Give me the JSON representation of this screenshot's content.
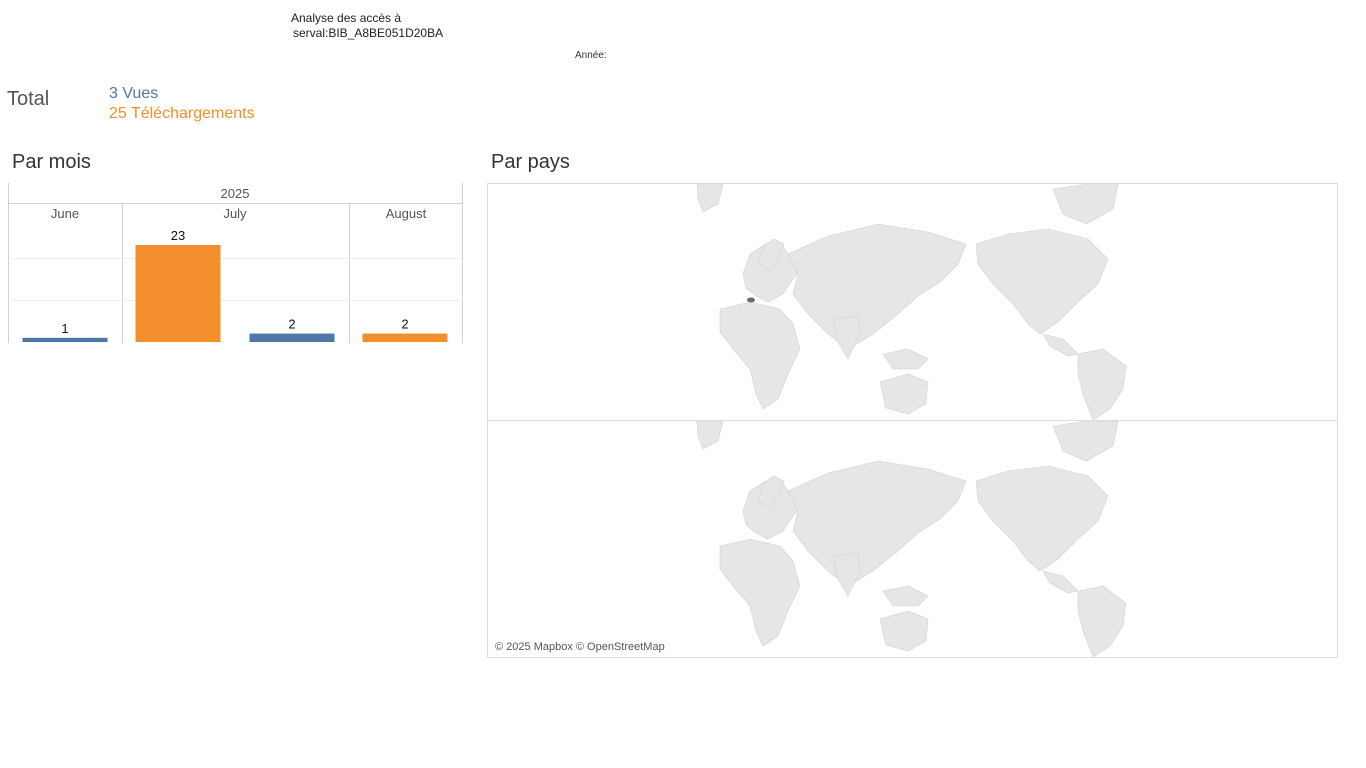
{
  "header": {
    "title_line1": "Analyse des accès à",
    "title_line2": "serval:BIB_A8BE051D20BA",
    "year_filter_label": "Année:"
  },
  "totals": {
    "label": "Total",
    "views": "3 Vues",
    "downloads": "25 Téléchargements"
  },
  "sections": {
    "by_month": "Par mois",
    "by_country": "Par pays"
  },
  "colors": {
    "views": "#4e79a7",
    "downloads": "#f28e2b",
    "map_land": "#e6e6e6",
    "map_highlight": "#6b6b6b",
    "grid": "#eeeeee"
  },
  "chart_data": {
    "type": "bar",
    "year_header": "2025",
    "categories": [
      "June",
      "July",
      "August"
    ],
    "series": [
      {
        "key": "views",
        "values": [
          1,
          2,
          null
        ]
      },
      {
        "key": "downloads",
        "values": [
          null,
          23,
          2
        ]
      }
    ],
    "bars": [
      {
        "month": "June",
        "series": "views",
        "value": 1,
        "label": "1"
      },
      {
        "month": "July",
        "series": "downloads",
        "value": 23,
        "label": "23"
      },
      {
        "month": "July",
        "series": "views",
        "value": 2,
        "label": "2"
      },
      {
        "month": "August",
        "series": "downloads",
        "value": 2,
        "label": "2"
      }
    ],
    "ylim": [
      0,
      23
    ],
    "grid": true,
    "legend": "none"
  },
  "map": {
    "credit": "© 2025 Mapbox © OpenStreetMap",
    "panels": 2,
    "highlighted_region": "Switzerland"
  }
}
